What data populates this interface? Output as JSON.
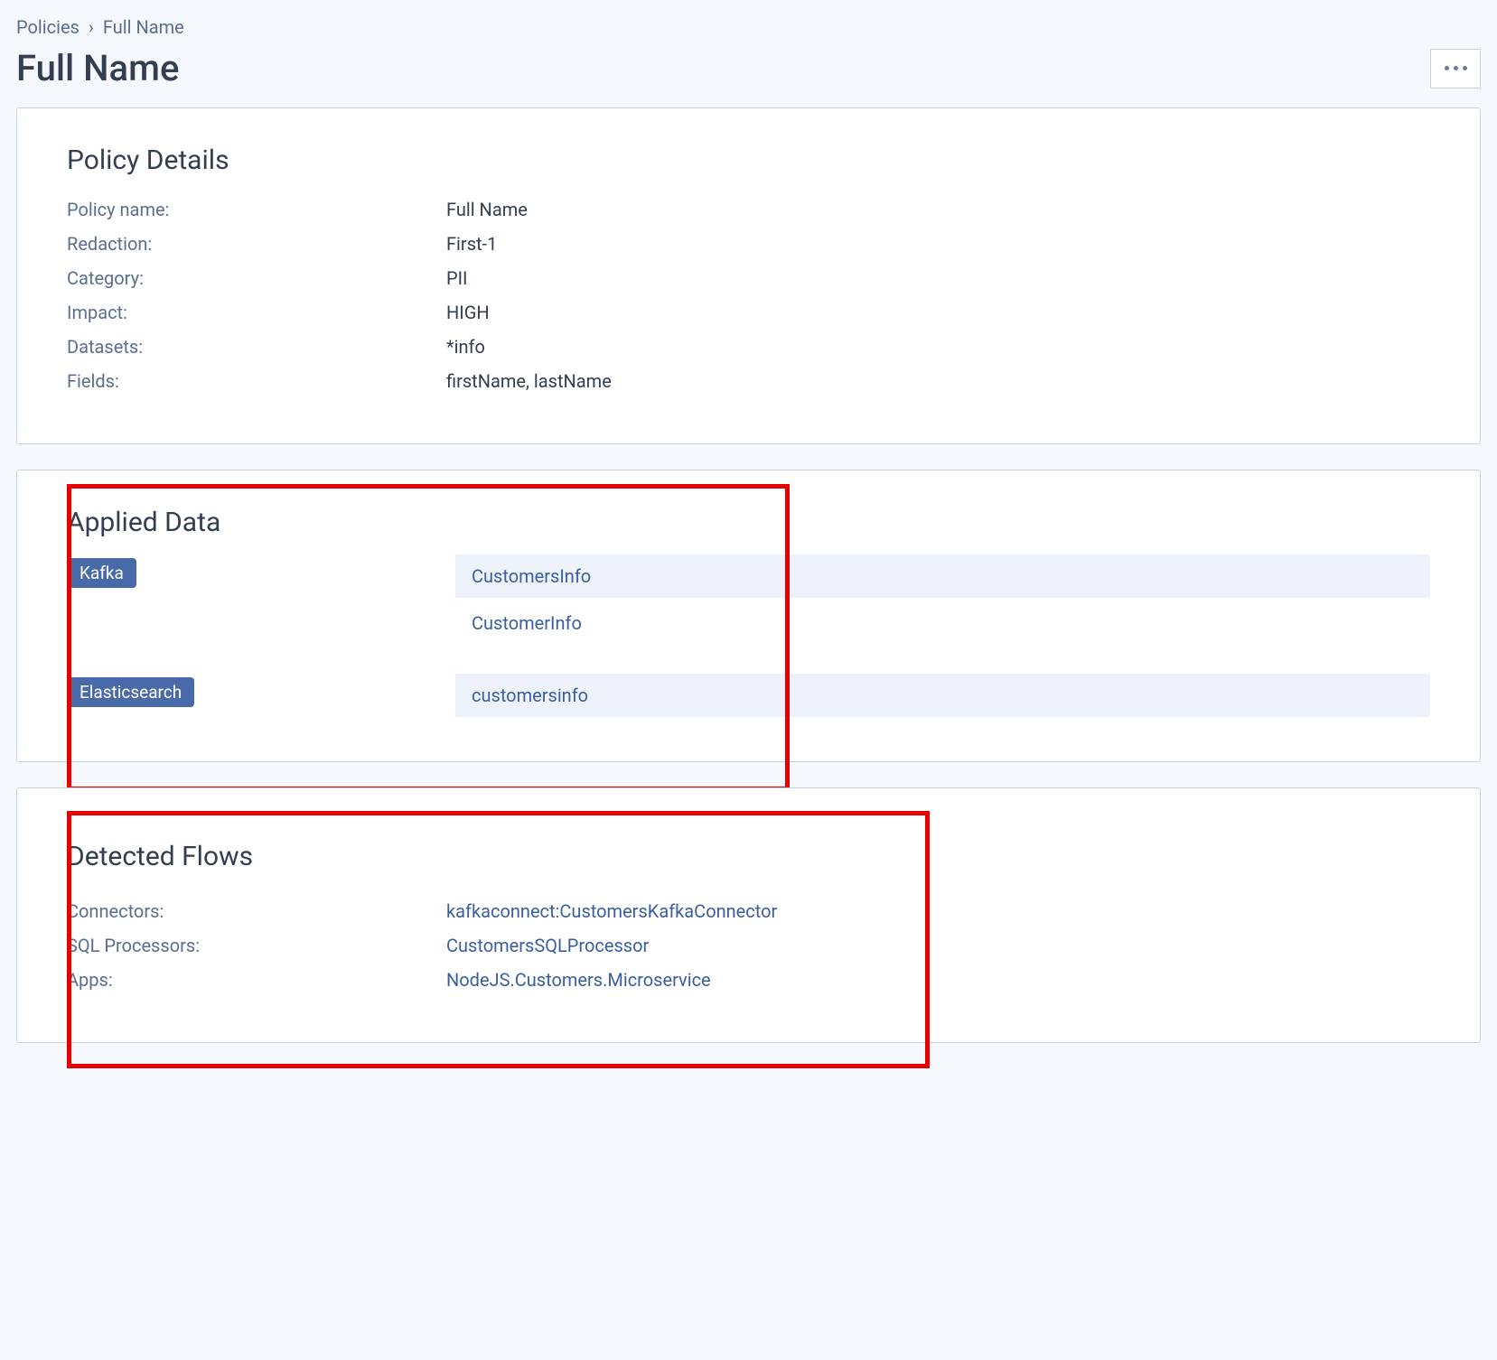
{
  "breadcrumb": {
    "root": "Policies",
    "current": "Full Name"
  },
  "page_title": "Full Name",
  "policy_details": {
    "heading": "Policy Details",
    "rows": {
      "policy_name": {
        "label": "Policy name:",
        "value": "Full Name"
      },
      "redaction": {
        "label": "Redaction:",
        "value": "First-1"
      },
      "category": {
        "label": "Category:",
        "value": "PII"
      },
      "impact": {
        "label": "Impact:",
        "value": "HIGH"
      },
      "datasets": {
        "label": "Datasets:",
        "value": "*info"
      },
      "fields": {
        "label": "Fields:",
        "value": "firstName, lastName"
      }
    }
  },
  "applied_data": {
    "heading": "Applied Data",
    "groups": [
      {
        "tag": "Kafka",
        "items": [
          "CustomersInfo",
          "CustomerInfo"
        ]
      },
      {
        "tag": "Elasticsearch",
        "items": [
          "customersinfo"
        ]
      }
    ]
  },
  "detected_flows": {
    "heading": "Detected Flows",
    "rows": {
      "connectors": {
        "label": "Connectors:",
        "value": "kafkaconnect:CustomersKafkaConnector"
      },
      "sql_processors": {
        "label": "SQL Processors:",
        "value": "CustomersSQLProcessor"
      },
      "apps": {
        "label": "Apps:",
        "value": "NodeJS.Customers.Microservice"
      }
    }
  }
}
